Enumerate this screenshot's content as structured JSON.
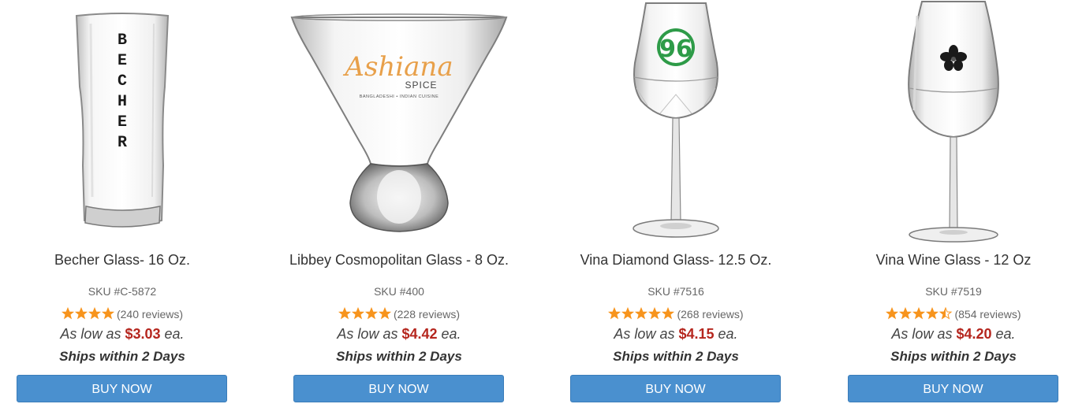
{
  "products": [
    {
      "title": "Becher Glass- 16 Oz.",
      "sku": "SKU #C-5872",
      "rating_value": 4,
      "reviews": "(240 reviews)",
      "price_prefix": "As low as",
      "price": "$3.03",
      "price_suffix": "ea.",
      "shipping": "Ships within 2 Days",
      "button": "BUY NOW",
      "imprint": "BECHER"
    },
    {
      "title": "Libbey Cosmopolitan Glass - 8 Oz.",
      "sku": "SKU #400",
      "rating_value": 4,
      "reviews": "(228 reviews)",
      "price_prefix": "As low as",
      "price": "$4.42",
      "price_suffix": "ea.",
      "shipping": "Ships within 2 Days",
      "button": "BUY NOW",
      "imprint": "Ashiana",
      "imprint_sub": "SPICE",
      "imprint_tagline": "BANGLADESHI • INDIAN CUISINE"
    },
    {
      "title": "Vina Diamond Glass- 12.5 Oz.",
      "sku": "SKU #7516",
      "rating_value": 5,
      "reviews": "(268 reviews)",
      "price_prefix": "As low as",
      "price": "$4.15",
      "price_suffix": "ea.",
      "shipping": "Ships within 2 Days",
      "button": "BUY NOW",
      "imprint": "96"
    },
    {
      "title": "Vina Wine Glass - 12 Oz",
      "sku": "SKU #7519",
      "rating_value": 4.5,
      "reviews": "(854 reviews)",
      "price_prefix": "As low as",
      "price": "$4.20",
      "price_suffix": "ea.",
      "shipping": "Ships within 2 Days",
      "button": "BUY NOW"
    }
  ],
  "colors": {
    "star": "#f7941d",
    "price": "#b5261e",
    "button": "#4a90cf",
    "logo_orange": "#e8a04a",
    "logo_green": "#2e9b48"
  }
}
